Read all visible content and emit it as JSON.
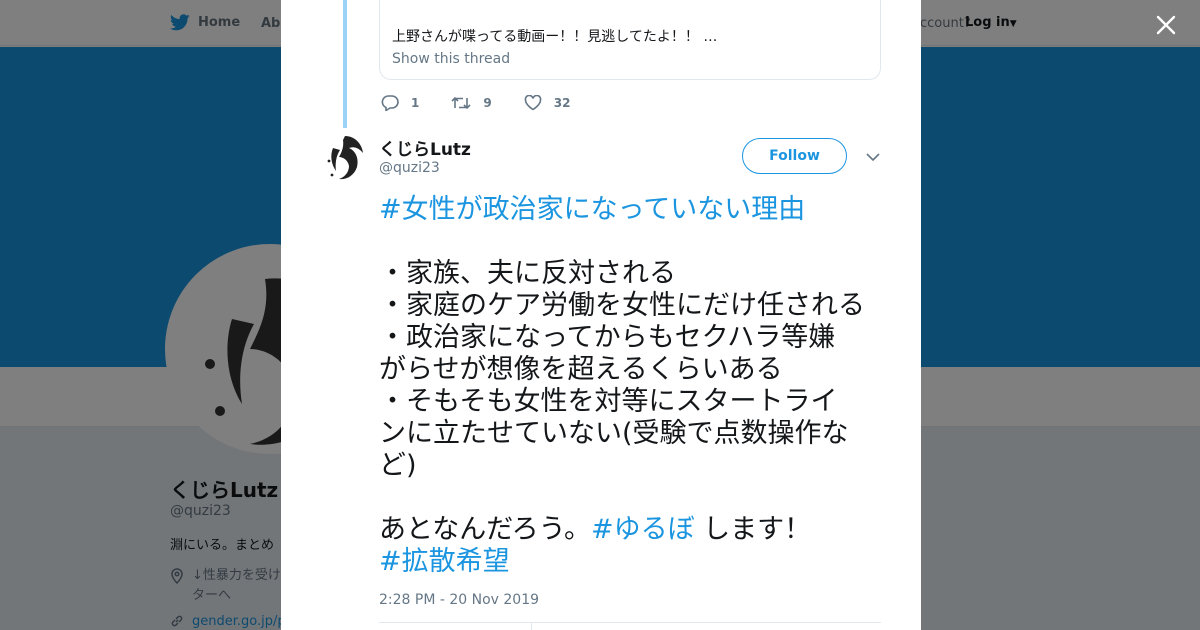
{
  "background": {
    "nav": {
      "home_label": "Home",
      "about_label": "Abo",
      "account_text": "ccount?",
      "login_label": "Log in"
    },
    "profile": {
      "name": "くじらLutz",
      "handle": "@quzi23",
      "bio": "淵にいる。まとめ",
      "location_line1": "↓性暴力を受け",
      "location_line2": "ターへ",
      "url": "gender.go.jp/p"
    }
  },
  "modal": {
    "quoted": {
      "text": "上野さんが喋ってる動画ー！！見逃してたよ！！ …",
      "show_thread": "Show this thread"
    },
    "stats": {
      "replies": "1",
      "retweets": "9",
      "likes": "32"
    },
    "tweet": {
      "author_name": "くじらLutz",
      "author_handle": "@quzi23",
      "follow_label": "Follow",
      "lines": {
        "l1": "#女性が政治家になっていない理由",
        "l2": "・家族、夫に反対される",
        "l3": "・家庭のケア労働を女性にだけ任される",
        "l4": "・政治家になってからもセクハラ等嫌",
        "l5": "がらせが想像を超えるくらいある",
        "l6": "・そもそも女性を対等にスタートライ",
        "l7": "ンに立たせていない(受験で点数操作な",
        "l8": "ど)",
        "l9_text": "あとなんだろう。",
        "l9_tag": "#ゆるぼ",
        "l9_end": " します！",
        "l10": "#拡散希望"
      },
      "timestamp": "2:28 PM - 20 Nov 2019"
    }
  },
  "icons": {
    "twitter_bird": "twitter-bird-icon",
    "close": "close-icon",
    "reply": "reply-icon",
    "retweet": "retweet-icon",
    "like": "heart-icon",
    "chevron": "chevron-down-icon",
    "location": "location-pin-icon",
    "link": "link-icon"
  },
  "colors": {
    "accent": "#1b95e0",
    "thread_line": "#9bd2f6",
    "text": "#14171a",
    "muted": "#657786"
  }
}
